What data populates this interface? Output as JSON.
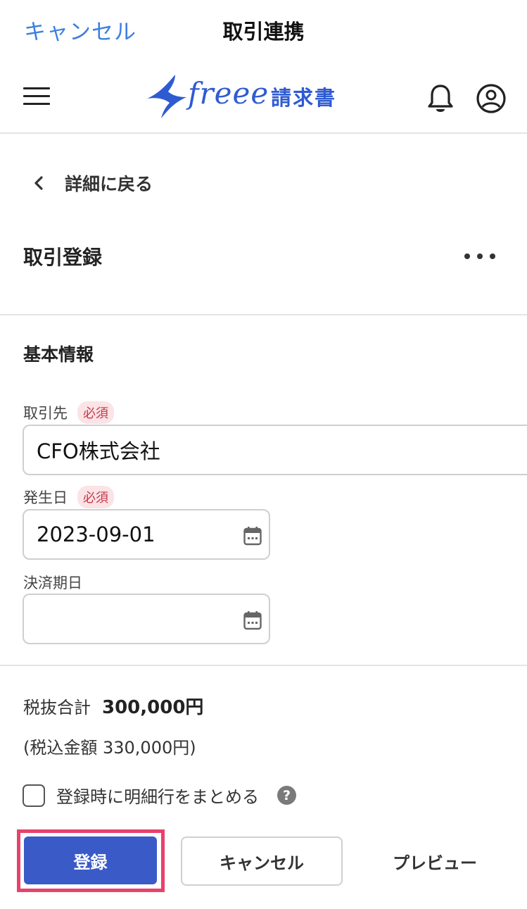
{
  "topbar": {
    "cancel": "キャンセル",
    "title": "取引連携"
  },
  "header": {
    "logo_word": "freee",
    "product": "請求書"
  },
  "back": {
    "label": "詳細に戻る"
  },
  "page": {
    "title": "取引登録"
  },
  "section": {
    "title": "基本情報"
  },
  "fields": {
    "partner": {
      "label": "取引先",
      "badge": "必須",
      "value": "CFO株式会社"
    },
    "issue_date": {
      "label": "発生日",
      "badge": "必須",
      "value": "2023-09-01"
    },
    "due_date": {
      "label": "決済期日",
      "value": ""
    }
  },
  "totals": {
    "subtotal_label": "税抜合計",
    "subtotal_value": "300,000円",
    "tax_included": "(税込金額 330,000円)"
  },
  "options": {
    "merge_label": "登録時に明細行をまとめる",
    "help": "?"
  },
  "buttons": {
    "register": "登録",
    "cancel": "キャンセル",
    "preview": "プレビュー"
  },
  "colors": {
    "accent": "#3a5bc7",
    "link": "#3d7fe0",
    "highlight": "#e8416b",
    "required_badge": "#fbe3e6"
  }
}
